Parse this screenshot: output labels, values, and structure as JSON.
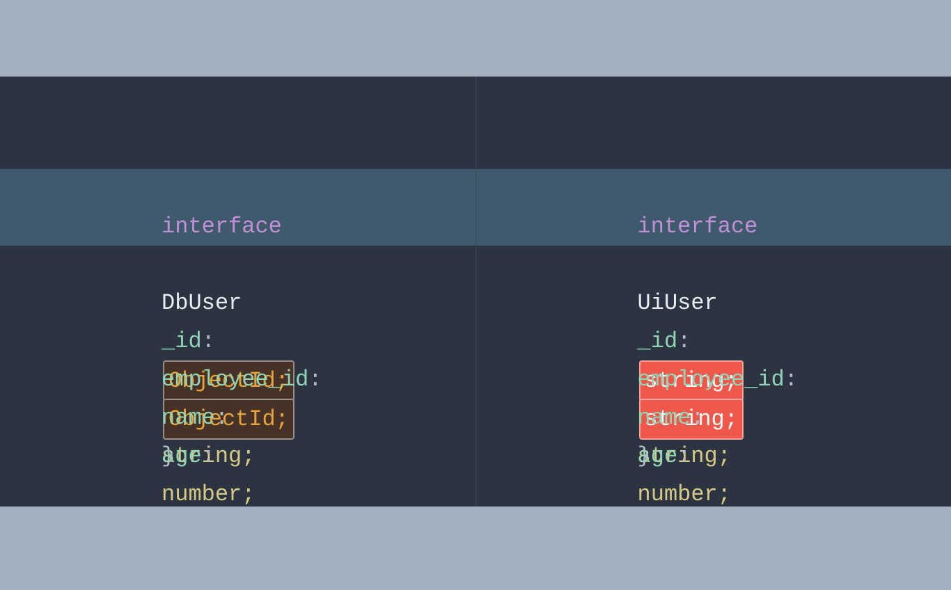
{
  "left": {
    "keyword": "interface",
    "typeName": "DbUser",
    "brace_open": "{",
    "brace_close": "}",
    "fields": {
      "row1_name": "_id",
      "row1_type": "ObjectId;",
      "row2_name": "employee_id",
      "row2_type": "ObjectId;",
      "row4_name": "name",
      "row4_type": "string;",
      "row5_name": "age",
      "row5_type": "number;"
    }
  },
  "right": {
    "keyword": "interface",
    "typeName": "UiUser",
    "brace_open": "{",
    "brace_close": "}",
    "fields": {
      "row1_name": "_id",
      "row1_type": "string;",
      "row2_name": "employee_id",
      "row2_type": "string;",
      "row4_name": "name",
      "row4_type": "string;",
      "row5_name": "age",
      "row5_type": "number;"
    }
  }
}
